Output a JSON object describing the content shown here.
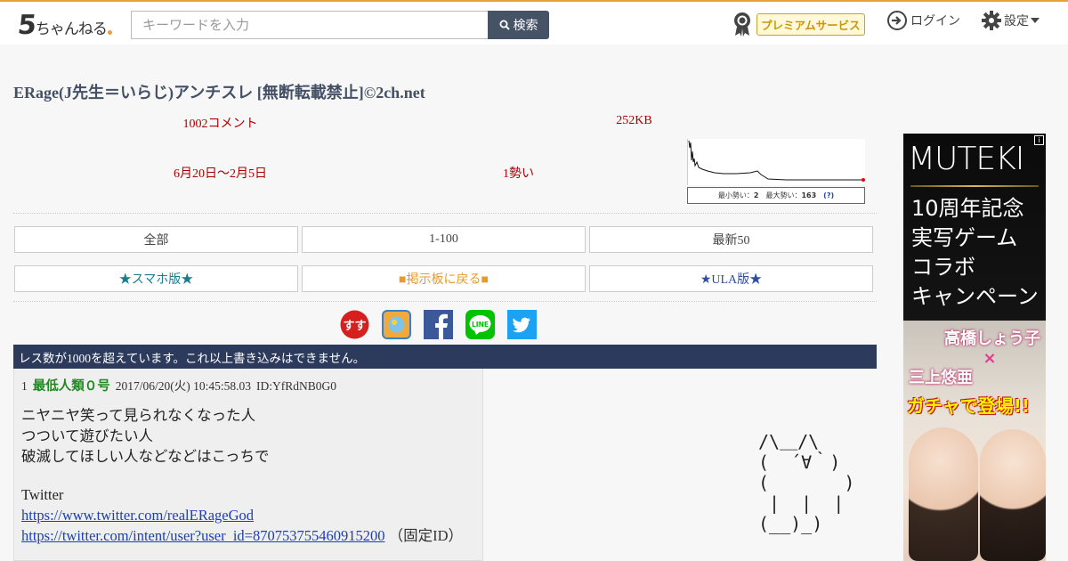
{
  "header": {
    "logo_number": "5",
    "logo_kana": "ちゃんねる",
    "search_placeholder": "キーワードを入力",
    "search_button": "検索",
    "premium_label": "プレミアムサービス",
    "login_label": "ログイン",
    "settings_label": "設定"
  },
  "thread": {
    "title": "ERage(J先生＝いらじ)アンチスレ [無断転載禁止]©2ch.net",
    "comments": "1002コメント",
    "size": "252KB",
    "dates": "6月20日〜2月5日",
    "momentum": "1勢い",
    "graph": {
      "min_label": "最小勢い：",
      "min_value": "2",
      "max_label": "最大勢い：",
      "max_value": "163",
      "help": "(?)"
    }
  },
  "nav": {
    "all": "全部",
    "range": "1-100",
    "latest": "最新50",
    "smartphone": "★スマホ版★",
    "board": "■掲示板に戻る■",
    "ula": "★ULA版★"
  },
  "share": {
    "icons": [
      "sussu-icon",
      "hatena-icon",
      "facebook-icon",
      "line-icon",
      "twitter-icon"
    ],
    "colors": {
      "sussu": "#d62020",
      "facebook": "#3b5998",
      "line": "#00c300",
      "twitter": "#1da1f2"
    }
  },
  "notice": "レス数が1000を超えています。これ以上書き込みはできません。",
  "post": {
    "number": "1",
    "name": "最低人類０号",
    "datetime": "2017/06/20(火) 10:45:58.03",
    "id": "ID:YfRdNB0G0",
    "lines": [
      "ニヤニヤ笑って見られなくなった人",
      "つついて遊びたい人",
      "破滅してほしい人などなどはこっちで"
    ],
    "twitter_label": "Twitter",
    "link1": "https://www.twitter.com/realERageGod",
    "link2": "https://twitter.com/intent/user?user_id=870753755460915200",
    "link2_note": "（固定ID）"
  },
  "ascii_art": "/\\＿/\\\n(  ´∀｀)\n(       )\n |  |  |\n(__)_)",
  "ad": {
    "brand": "MUTEKI",
    "headline_lines": [
      "10周年記念",
      "実写ゲーム",
      "コラボ",
      "キャンペーン"
    ],
    "name1": "高橋しょう子",
    "cross": "×",
    "name2": "三上悠亜",
    "cta": "ガチャで登場!!",
    "info": "i"
  }
}
